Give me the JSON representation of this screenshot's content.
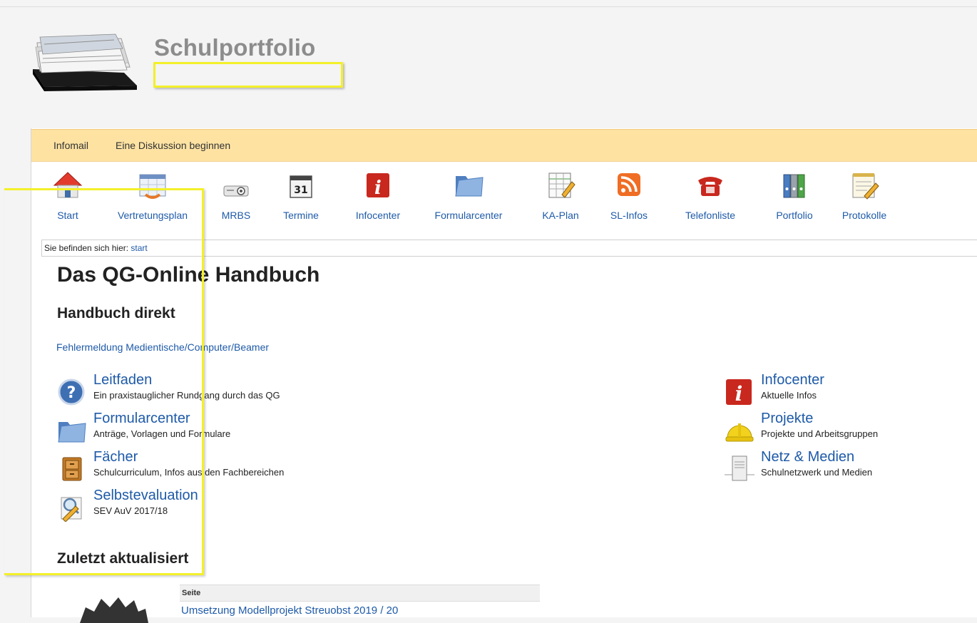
{
  "header": {
    "site_title": "Schulportfolio"
  },
  "menubar": {
    "items": [
      {
        "label": "Infomail"
      },
      {
        "label": "Eine Diskussion beginnen"
      }
    ]
  },
  "iconbar": {
    "items": [
      {
        "label": "Start",
        "icon": "home-icon"
      },
      {
        "label": "Vertretungsplan",
        "icon": "calendar-sync-icon"
      },
      {
        "label": "MRBS",
        "icon": "projector-icon"
      },
      {
        "label": "Termine",
        "icon": "calendar-31-icon"
      },
      {
        "label": "Infocenter",
        "icon": "info-icon"
      },
      {
        "label": "Formularcenter",
        "icon": "folder-icon"
      },
      {
        "label": "KA-Plan",
        "icon": "spreadsheet-edit-icon"
      },
      {
        "label": "SL-Infos",
        "icon": "rss-icon"
      },
      {
        "label": "Telefonliste",
        "icon": "telephone-icon"
      },
      {
        "label": "Portfolio",
        "icon": "binders-icon"
      },
      {
        "label": "Protokolle",
        "icon": "notepad-icon"
      }
    ]
  },
  "breadcrumb": {
    "prefix": "Sie befinden sich hier:",
    "current": "start"
  },
  "main": {
    "title": "Das QG-Online Handbuch",
    "section_direct": "Handbuch direkt",
    "error_link": "Fehlermeldung Medientische/Computer/Beamer",
    "left_entries": [
      {
        "title": "Leitfaden",
        "desc": "Ein praxistauglicher Rundgang durch das QG",
        "icon": "help-icon"
      },
      {
        "title": "Formularcenter",
        "desc": "Anträge, Vorlagen und Formulare",
        "icon": "folder-icon"
      },
      {
        "title": "Fächer",
        "desc": "Schulcurriculum, Infos aus den Fachbereichen",
        "icon": "cabinet-icon"
      },
      {
        "title": "Selbstevaluation",
        "desc": "SEV AuV 2017/18",
        "icon": "magnifier-pencil-icon"
      }
    ],
    "right_entries": [
      {
        "title": "Infocenter",
        "desc": "Aktuelle Infos",
        "icon": "info-icon"
      },
      {
        "title": "Projekte",
        "desc": "Projekte und Arbeitsgruppen",
        "icon": "hardhat-icon"
      },
      {
        "title": "Netz & Medien",
        "desc": "Schulnetzwerk und Medien",
        "icon": "server-icon"
      }
    ],
    "section_recent": "Zuletzt aktualisiert",
    "recent": {
      "column_header": "Seite",
      "rows": [
        "Umsetzung Modellprojekt Streuobst 2019 / 20"
      ]
    }
  },
  "colors": {
    "link": "#1e5aa8",
    "menubar_bg": "#fde2a2",
    "highlight": "#f3f02a",
    "title_gray": "#8c8c8c"
  }
}
